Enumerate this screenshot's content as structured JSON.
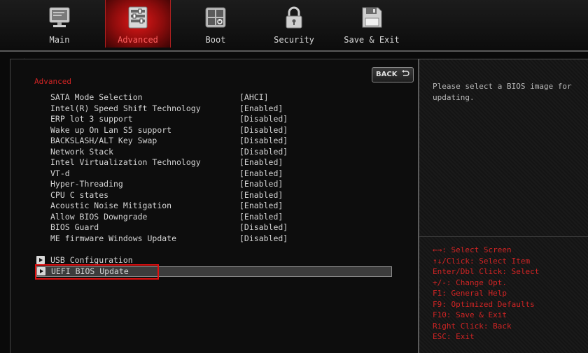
{
  "tabs": [
    {
      "label": "Main",
      "icon": "monitor-icon"
    },
    {
      "label": "Advanced",
      "icon": "advanced-settings-icon"
    },
    {
      "label": "Boot",
      "icon": "boot-icon"
    },
    {
      "label": "Security",
      "icon": "lock-icon"
    },
    {
      "label": "Save & Exit",
      "icon": "floppy-disk-icon"
    }
  ],
  "active_tab": "Advanced",
  "main": {
    "section_title": "Advanced",
    "back_label": "BACK",
    "settings": [
      {
        "name": "SATA Mode Selection",
        "value": "[AHCI]"
      },
      {
        "name": "Intel(R) Speed Shift Technology",
        "value": "[Enabled]"
      },
      {
        "name": "ERP lot 3 support",
        "value": "[Disabled]"
      },
      {
        "name": "Wake up On Lan S5 support",
        "value": "[Disabled]"
      },
      {
        "name": "BACKSLASH/ALT Key Swap",
        "value": "[Disabled]"
      },
      {
        "name": "Network Stack",
        "value": "[Disabled]"
      },
      {
        "name": "Intel Virtualization Technology",
        "value": "[Enabled]"
      },
      {
        "name": "VT-d",
        "value": "[Enabled]"
      },
      {
        "name": "Hyper-Threading",
        "value": "[Enabled]"
      },
      {
        "name": "CPU C states",
        "value": "[Enabled]"
      },
      {
        "name": "Acoustic Noise Mitigation",
        "value": "[Enabled]"
      },
      {
        "name": "Allow BIOS Downgrade",
        "value": "[Enabled]"
      },
      {
        "name": "BIOS Guard",
        "value": "[Disabled]"
      },
      {
        "name": "ME firmware Windows Update",
        "value": "[Disabled]"
      }
    ],
    "submenus": [
      {
        "label": "USB Configuration"
      },
      {
        "label": "UEFI BIOS Update"
      }
    ],
    "selected_submenu": "UEFI BIOS Update"
  },
  "help": {
    "text": "Please select a BIOS image for updating.",
    "keys": [
      "←→: Select Screen",
      "↑↓/Click: Select Item",
      "Enter/Dbl Click: Select",
      "+/-: Change Opt.",
      "F1: General Help",
      "F9: Optimized Defaults",
      "F10: Save & Exit",
      "Right Click: Back",
      "ESC: Exit"
    ]
  },
  "colors": {
    "accent_red": "#d02424",
    "background": "#0a0a0a",
    "text": "#d4d4d4"
  }
}
